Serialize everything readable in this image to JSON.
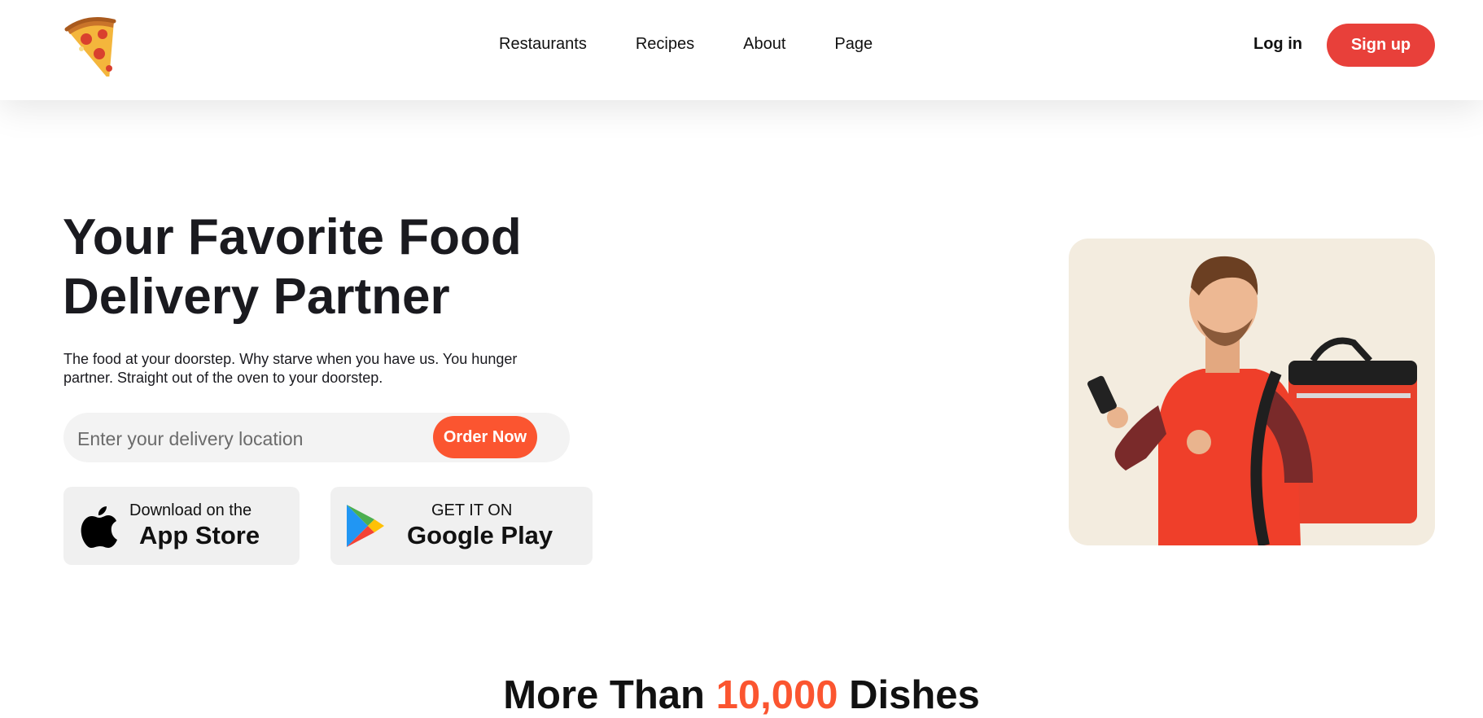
{
  "nav": {
    "logo_icon": "pizza-slice-icon",
    "links": [
      "Restaurants",
      "Recipes",
      "About",
      "Page"
    ],
    "login": "Log in",
    "signup": "Sign up"
  },
  "hero": {
    "title_line1": "Your Favorite Food",
    "title_line2": "Delivery Partner",
    "description": "The food at your doorstep. Why starve when you have us. You hunger partner. Straight out of the oven to your doorstep.",
    "search_placeholder": "Enter your delivery location",
    "order_button": "Order Now",
    "appstore": {
      "small": "Download on the",
      "big": "App Store",
      "icon": "apple-icon"
    },
    "googleplay": {
      "small": "GET IT ON",
      "big": "Google Play",
      "icon": "google-play-icon"
    },
    "image": "delivery-man-illustration"
  },
  "section": {
    "title_prefix": "More Than ",
    "title_highlight": "10,000",
    "title_suffix": " Dishes"
  },
  "colors": {
    "accent": "#fb5530",
    "signup": "#e8403a",
    "text": "#1a1a1f",
    "image_bg": "#f3ecdf"
  }
}
